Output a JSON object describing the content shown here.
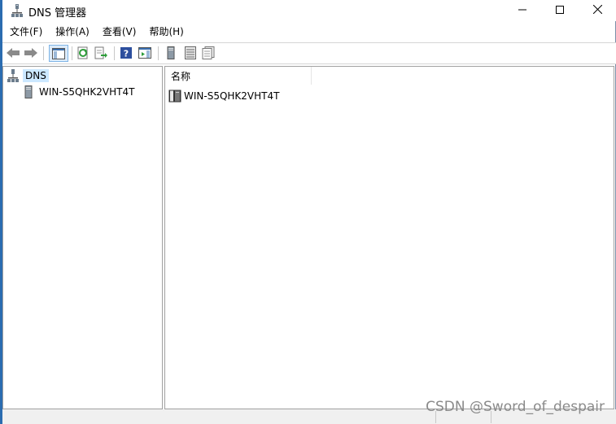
{
  "window": {
    "title": "DNS 管理器",
    "buttons": {
      "minimize": "minimize-icon",
      "maximize": "maximize-icon",
      "close": "close-icon"
    }
  },
  "menu": [
    "文件(F)",
    "操作(A)",
    "查看(V)",
    "帮助(H)"
  ],
  "toolbar": [
    "back-arrow-icon",
    "forward-arrow-icon",
    "show-hide-tree-icon",
    "refresh-icon",
    "export-list-icon",
    "help-icon",
    "action-pane-icon",
    "server-icon",
    "record-list-icon",
    "properties-icon"
  ],
  "tree": {
    "root": {
      "label": "DNS",
      "icon": "dns-icon",
      "selected": true
    },
    "children": [
      {
        "label": "WIN-S5QHK2VHT4T",
        "icon": "server-icon"
      }
    ]
  },
  "list": {
    "columns": [
      "名称"
    ],
    "rows": [
      {
        "name": "WIN-S5QHK2VHT4T",
        "icon": "server-icon"
      }
    ]
  },
  "watermark": "CSDN @Sword_of_despair",
  "colors": {
    "selection": "#cce8ff",
    "accent": "#2b6cb0"
  }
}
